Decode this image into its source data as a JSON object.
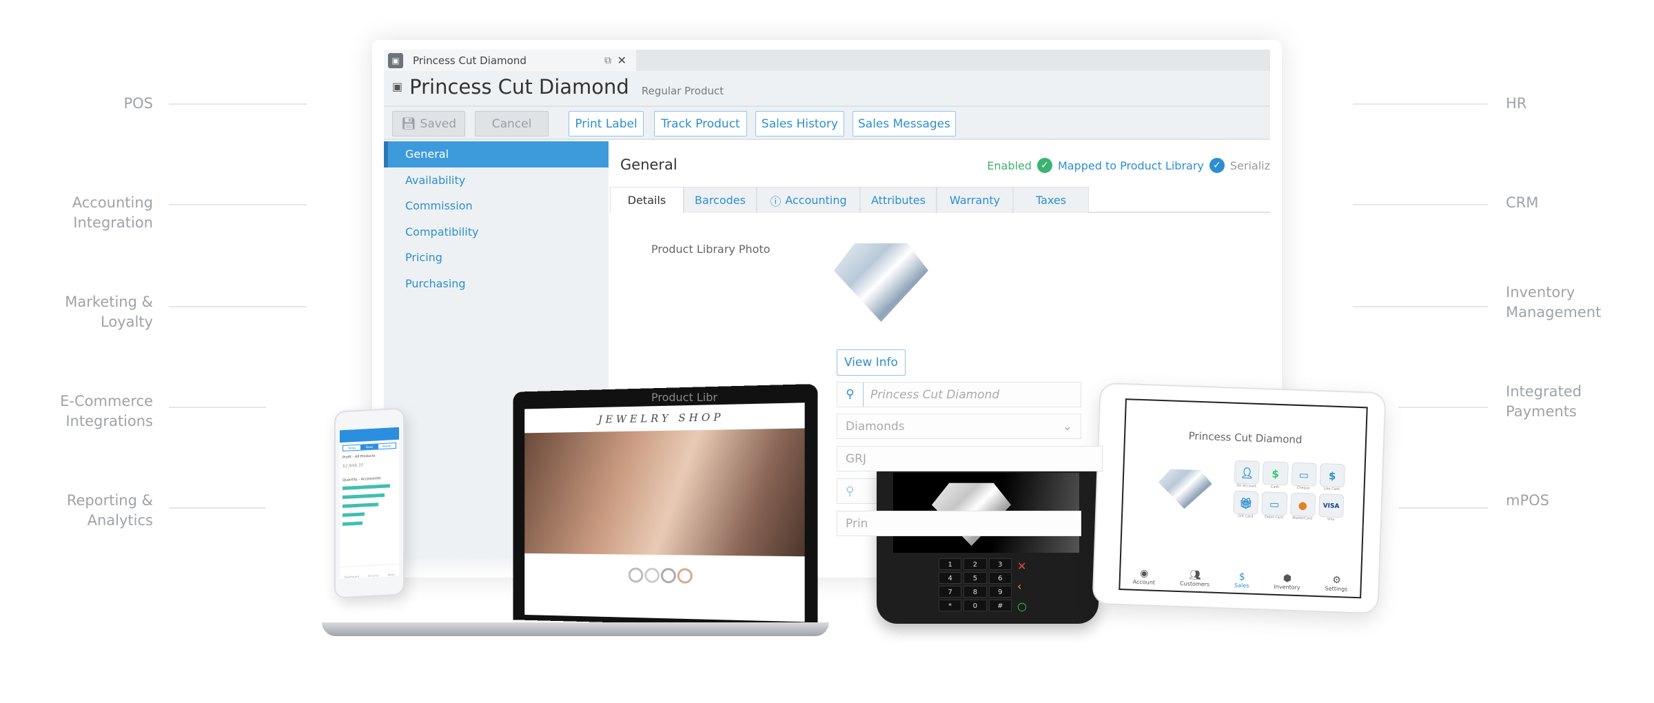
{
  "left_labels": [
    {
      "lines": [
        "POS"
      ]
    },
    {
      "lines": [
        "Accounting",
        "Integration"
      ]
    },
    {
      "lines": [
        "Marketing &",
        "Loyalty"
      ]
    },
    {
      "lines": [
        "E-Commerce",
        "Integrations"
      ]
    },
    {
      "lines": [
        "Reporting &",
        "Analytics"
      ]
    }
  ],
  "right_labels": [
    {
      "lines": [
        "HR"
      ]
    },
    {
      "lines": [
        "CRM"
      ]
    },
    {
      "lines": [
        "Inventory",
        "Management"
      ]
    },
    {
      "lines": [
        "Integrated",
        "Payments"
      ]
    },
    {
      "lines": [
        "mPOS"
      ]
    }
  ],
  "window": {
    "tab_title": "Princess Cut Diamond",
    "title": "Princess Cut Diamond",
    "subtitle": "Regular Product",
    "toolbar": {
      "saved": "Saved",
      "cancel": "Cancel",
      "print_label": "Print Label",
      "track_product": "Track Product",
      "sales_history": "Sales History",
      "sales_messages": "Sales Messages"
    },
    "sidebar": [
      "General",
      "Availability",
      "Commission",
      "Compatibility",
      "Pricing",
      "Purchasing"
    ],
    "section_title": "General",
    "status": {
      "enabled": "Enabled",
      "mapped": "Mapped to Product Library",
      "serialized": "Serializ"
    },
    "tabs": [
      "Details",
      "Barcodes",
      "Accounting",
      "Attributes",
      "Warranty",
      "Taxes"
    ],
    "photo_label": "Product Library Photo",
    "view_info": "View Info",
    "library_label": "Product Libr",
    "search_placeholder": "Princess Cut Diamond",
    "category": "Diamonds",
    "code": "GRJ",
    "partial": "Prin"
  },
  "colors": {
    "accent": "#2b8fd0",
    "active": "#3d9bdc",
    "enabled": "#3cb371",
    "label": "#9ea3a8"
  },
  "phone": {
    "tabs": [
      "Today",
      "Week",
      "Month"
    ],
    "card1": "Profit - All Products",
    "value": "$2,848.35",
    "card2": "Quantity - Accessories",
    "bars": [
      100,
      88,
      76,
      47,
      42
    ],
    "nav": [
      "Dashboard",
      "Security",
      "More"
    ]
  },
  "laptop": {
    "brand": "JEWELRY SHOP"
  },
  "terminal": {
    "keys": [
      "1",
      "2",
      "3",
      "4",
      "5",
      "6",
      "7",
      "8",
      "9",
      "*",
      "0",
      "#"
    ]
  },
  "tablet": {
    "title": "Princess Cut Diamond",
    "tenders": [
      "On Account",
      "Cash",
      "Cheque",
      "Like Cash",
      "Gift Card",
      "Debit Card",
      "MasterCard",
      "Visa"
    ],
    "nav": [
      "Account",
      "Customers",
      "Sales",
      "Inventory",
      "Settings"
    ],
    "active_nav": "Sales"
  }
}
